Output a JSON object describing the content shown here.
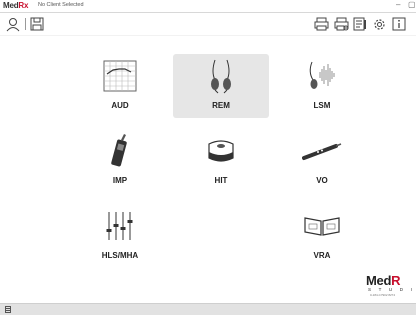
{
  "titlebar": {
    "brand_prefix": "Med",
    "brand_suffix": "Rx",
    "client_status": "No Client Selected",
    "minimize": "–",
    "restore": "▢"
  },
  "toolbar": {
    "left": [
      "client-icon",
      "save-icon"
    ],
    "right": [
      "print-icon",
      "print-preview-icon",
      "report-icon",
      "gear-icon",
      "info-icon"
    ]
  },
  "modules": [
    {
      "label": "AUD",
      "icon": "audiogram-icon",
      "selected": false
    },
    {
      "label": "REM",
      "icon": "probe-tube-icon",
      "selected": true
    },
    {
      "label": "LSM",
      "icon": "live-speech-icon",
      "selected": false
    },
    {
      "label": "IMP",
      "icon": "impedance-probe-icon",
      "selected": false
    },
    {
      "label": "HIT",
      "icon": "test-box-icon",
      "selected": false
    },
    {
      "label": "VO",
      "icon": "video-otoscope-icon",
      "selected": false
    },
    {
      "label": "HLS/MHA",
      "icon": "sliders-icon",
      "selected": false
    },
    {
      "label": "VRA",
      "icon": "vra-display-icon",
      "selected": false
    }
  ],
  "logo": {
    "main_prefix": "Med",
    "main_suffix": "R",
    "sub": "S T U D I",
    "small": "0-184-C7902 8274"
  },
  "colors": {
    "brand_red": "#c8102e",
    "selected_tile": "#e6e6e6",
    "window_bg": "#ffffff",
    "statusbar_bg": "#e2e2e2"
  }
}
